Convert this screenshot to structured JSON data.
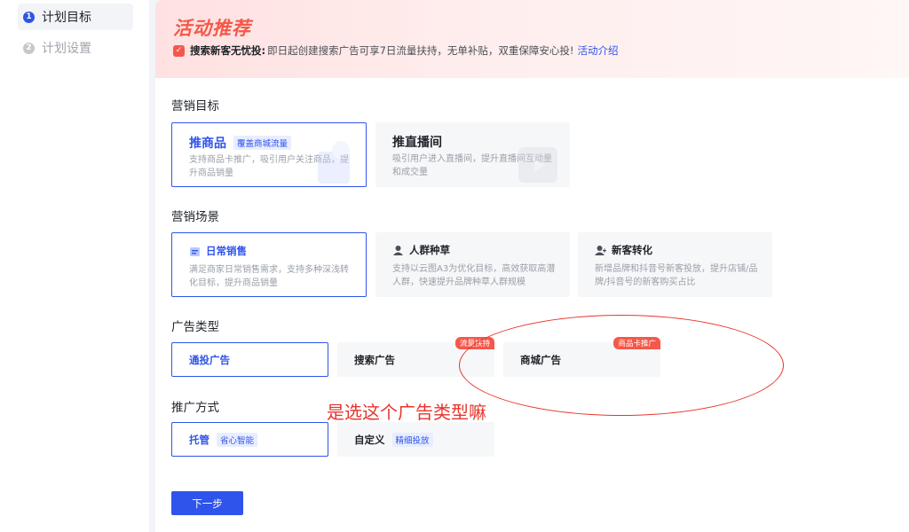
{
  "steps": [
    {
      "num": "1",
      "label": "计划目标"
    },
    {
      "num": "2",
      "label": "计划设置"
    }
  ],
  "banner": {
    "title": "活动推荐",
    "icon": "✓",
    "strong": "搜索新客无忧投:",
    "text": "即日起创建搜索广告可享7日流量扶持，无单补贴，双重保障安心投!",
    "link": "活动介绍"
  },
  "sections": {
    "marketing_goal": {
      "title": "营销目标",
      "cards": [
        {
          "title": "推商品",
          "tag": "覆盖商城流量",
          "desc1": "支持商品卡推广，吸引用户关注商品，提",
          "desc2": "升商品销量"
        },
        {
          "title": "推直播间",
          "desc1": "吸引用户进入直播间，提升直播间互动量",
          "desc2": "和成交量"
        }
      ]
    },
    "marketing_scene": {
      "title": "营销场景",
      "cards": [
        {
          "title": "日常销售",
          "desc1": "满足商家日常销售需求，支持多种深浅转",
          "desc2": "化目标，提升商品销量"
        },
        {
          "title": "人群种草",
          "desc1": "支持以云图A3为优化目标，高效获取高潜",
          "desc2": "人群，快速提升品牌种草人群规模"
        },
        {
          "title": "新客转化",
          "desc1": "新增品牌和抖音号新客投放，提升店铺/品",
          "desc2": "牌/抖音号的新客购买占比"
        }
      ]
    },
    "ad_type": {
      "title": "广告类型",
      "cards": [
        {
          "label": "通投广告"
        },
        {
          "label": "搜索广告",
          "ribbon": "流量扶持"
        },
        {
          "label": "商城广告",
          "ribbon": "商品卡推广"
        }
      ]
    },
    "promo_method": {
      "title": "推广方式",
      "cards": [
        {
          "label": "托管",
          "tag": "省心智能"
        },
        {
          "label": "自定义",
          "tag": "精细投放"
        }
      ]
    }
  },
  "next_button": "下一步",
  "annotation": {
    "text": "是选这个广告类型嘛",
    "color": "#e8342c"
  },
  "colors": {
    "primary": "#2f54eb",
    "accent_red": "#f5584a"
  }
}
